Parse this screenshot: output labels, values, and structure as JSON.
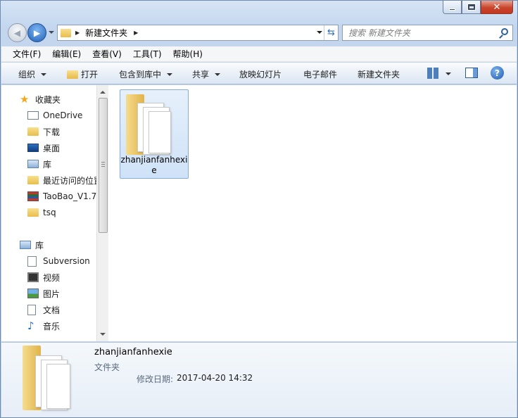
{
  "window": {
    "caption_min": "minimize",
    "caption_max": "maximize",
    "caption_close": "close"
  },
  "address_bar": {
    "path": "新建文件夹",
    "refresh_icon": "refresh-icon"
  },
  "search": {
    "placeholder": "搜索 新建文件夹"
  },
  "menu": {
    "items": [
      "文件(F)",
      "编辑(E)",
      "查看(V)",
      "工具(T)",
      "帮助(H)"
    ]
  },
  "toolbar": {
    "organize": "组织",
    "open": "打开",
    "include_in_library": "包含到库中",
    "share": "共享",
    "slideshow": "放映幻灯片",
    "email": "电子邮件",
    "new_folder": "新建文件夹"
  },
  "nav_pane": {
    "favorites": "收藏夹",
    "favorites_items": [
      "OneDrive",
      "下载",
      "桌面",
      "库",
      "最近访问的位置",
      "TaoBao_V1.7",
      "tsq"
    ],
    "libraries": "库",
    "library_items": [
      "Subversion",
      "视频",
      "图片",
      "文档",
      "音乐"
    ]
  },
  "content": {
    "items": [
      {
        "name": "zhanjianfanhexie",
        "type": "folder",
        "selected": true
      }
    ]
  },
  "details": {
    "name": "zhanjianfanhexie",
    "type": "文件夹",
    "modified_label": "修改日期:",
    "modified_value": "2017-04-20 14:32"
  },
  "colors": {
    "frame": "#c3d6ee",
    "selection": "#cfe2f7",
    "selection_border": "#84acdd",
    "folder": "#e9bd4d"
  }
}
